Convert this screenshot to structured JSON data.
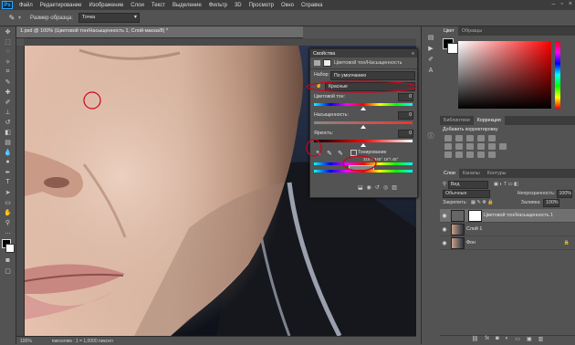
{
  "app": {
    "logo": "Ps"
  },
  "menu": [
    "Файл",
    "Редактирование",
    "Изображение",
    "Слои",
    "Текст",
    "Выделение",
    "Фильтр",
    "3D",
    "Просмотр",
    "Окно",
    "Справка"
  ],
  "options_bar": {
    "label": "Размер образца:",
    "value": "Точка"
  },
  "document": {
    "tab_title": "1.psd @ 100% (Цветовой тон/Насыщенность 1, Слой-маска/8) *",
    "close_glyph": "×",
    "zoom": "100%",
    "status": "пикселям : 1 = 1,0000 пиксел"
  },
  "properties": {
    "tab": "Свойства",
    "subtitle": "Цветовой тон/Насыщенность",
    "preset_label": "Набор:",
    "preset_value": "По умолчанию",
    "channel_value": "Красные",
    "hue_label": "Цветовой тон:",
    "hue_value": "0",
    "sat_label": "Насыщенность:",
    "sat_value": "0",
    "light_label": "Яркость:",
    "light_value": "0",
    "colorize_label": "Тонирование",
    "range_readout": "315°/ 345°    15°\\ 45°"
  },
  "color_panel": {
    "tabs": [
      "Цвет",
      "Образцы"
    ],
    "accent_hue": "#ff0000"
  },
  "corrections_panel": {
    "tabs": [
      "Библиотеки",
      "Коррекция"
    ],
    "title": "Добавить корректировку"
  },
  "layers_panel": {
    "tabs": [
      "Слои",
      "Каналы",
      "Контуры"
    ],
    "filter_label": "Вид",
    "blend_mode": "Обычные",
    "opacity_label": "Непрозрачность:",
    "opacity_value": "100%",
    "lock_label": "Закрепить:",
    "fill_label": "Заливка:",
    "fill_value": "100%",
    "layers": [
      {
        "name": "Цветовой тон/Насыщенность 1",
        "type": "adjustment"
      },
      {
        "name": "Слой 1",
        "type": "pixel"
      },
      {
        "name": "Фон",
        "type": "background"
      }
    ]
  },
  "annotations_color": "#d0021b"
}
